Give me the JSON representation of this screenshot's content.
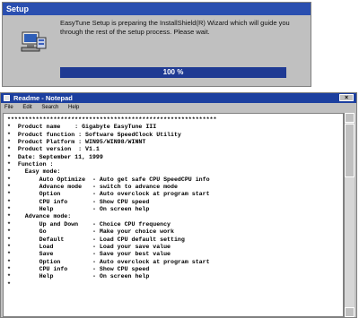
{
  "setup": {
    "title": "Setup",
    "message": "EasyTune Setup is preparing the InstallShield(R) Wizard which will guide you through the rest of the setup process. Please wait.",
    "progress_text": "100 %",
    "progress_value": 1.0,
    "icon": "computer-install-icon"
  },
  "notepad": {
    "title": "Readme - Notepad",
    "menu": [
      "File",
      "Edit",
      "Search",
      "Help"
    ],
    "lines": [
      "***********************************************************",
      "*  Product name    : Gigabyte EasyTune III",
      "*  Product function : Software SpeedClock Utility",
      "*  Product Platform : WIN95/WIN98/WINNT",
      "*  Product version  : V1.1",
      "*  Date: September 11, 1999",
      "*  Function :",
      "*    Easy mode:",
      "*        Auto Optimize  - Auto get safe CPU SpeedCPU info",
      "*        Advance mode   - switch to advance mode",
      "*        Option         - Auto overclock at program start",
      "*        CPU info       - Show CPU speed",
      "*        Help           - On screen help",
      "*    Advance mode:",
      "*        Up and Down    - Choice CPU frequency",
      "*        Go             - Make your choice work",
      "*        Default        - Load CPU default setting",
      "*        Load           - Load your save value",
      "*        Save           - Save your best value",
      "*        Option         - Auto overclock at program start",
      "*        CPU info       - Show CPU speed",
      "*        Help           - On screen help",
      "*"
    ],
    "close_glyph": "×"
  }
}
